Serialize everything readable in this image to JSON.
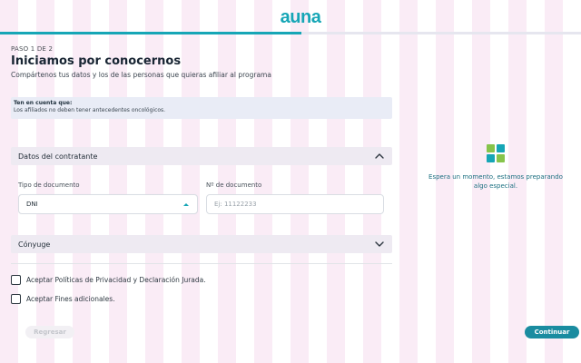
{
  "brand": {
    "logo_text": "auna",
    "primary_color": "#16a6b6",
    "accent_green": "#86c44b",
    "button_color": "#1a8ca0"
  },
  "header": {
    "step": "PASO 1 DE 2",
    "title": "Iniciamos por conocernos",
    "subtitle": "Compártenos tus datos y los de las personas que quieras afiliar al programa"
  },
  "notice": {
    "title": "Ten en cuenta que:",
    "text": "Los afiliados no deben tener antecedentes oncológicos."
  },
  "contratante": {
    "header": "Datos del contratante",
    "document_type_label": "Tipo de documento",
    "document_type_value": "DNI",
    "document_number_label": "Nº de documento",
    "document_number_placeholder": "Ej: 11122233"
  },
  "conyuge": {
    "header": "Cónyuge"
  },
  "checkboxes": [
    {
      "label": "Aceptar Políticas de Privacidad y Declaración Jurada.",
      "checked": false
    },
    {
      "label": "Aceptar Fines adicionales.",
      "checked": false
    }
  ],
  "buttons": {
    "back": "Regresar",
    "continue": "Continuar"
  },
  "loading": {
    "line1": "Espera un momento, estamos preparando",
    "line2": "algo especial."
  },
  "icons": {
    "logo": "auna-logo",
    "chevron_up": "chevron-up-icon",
    "chevron_down": "chevron-down-icon",
    "select_caret": "caret-up-icon",
    "loading": "tile-loader-icon"
  }
}
